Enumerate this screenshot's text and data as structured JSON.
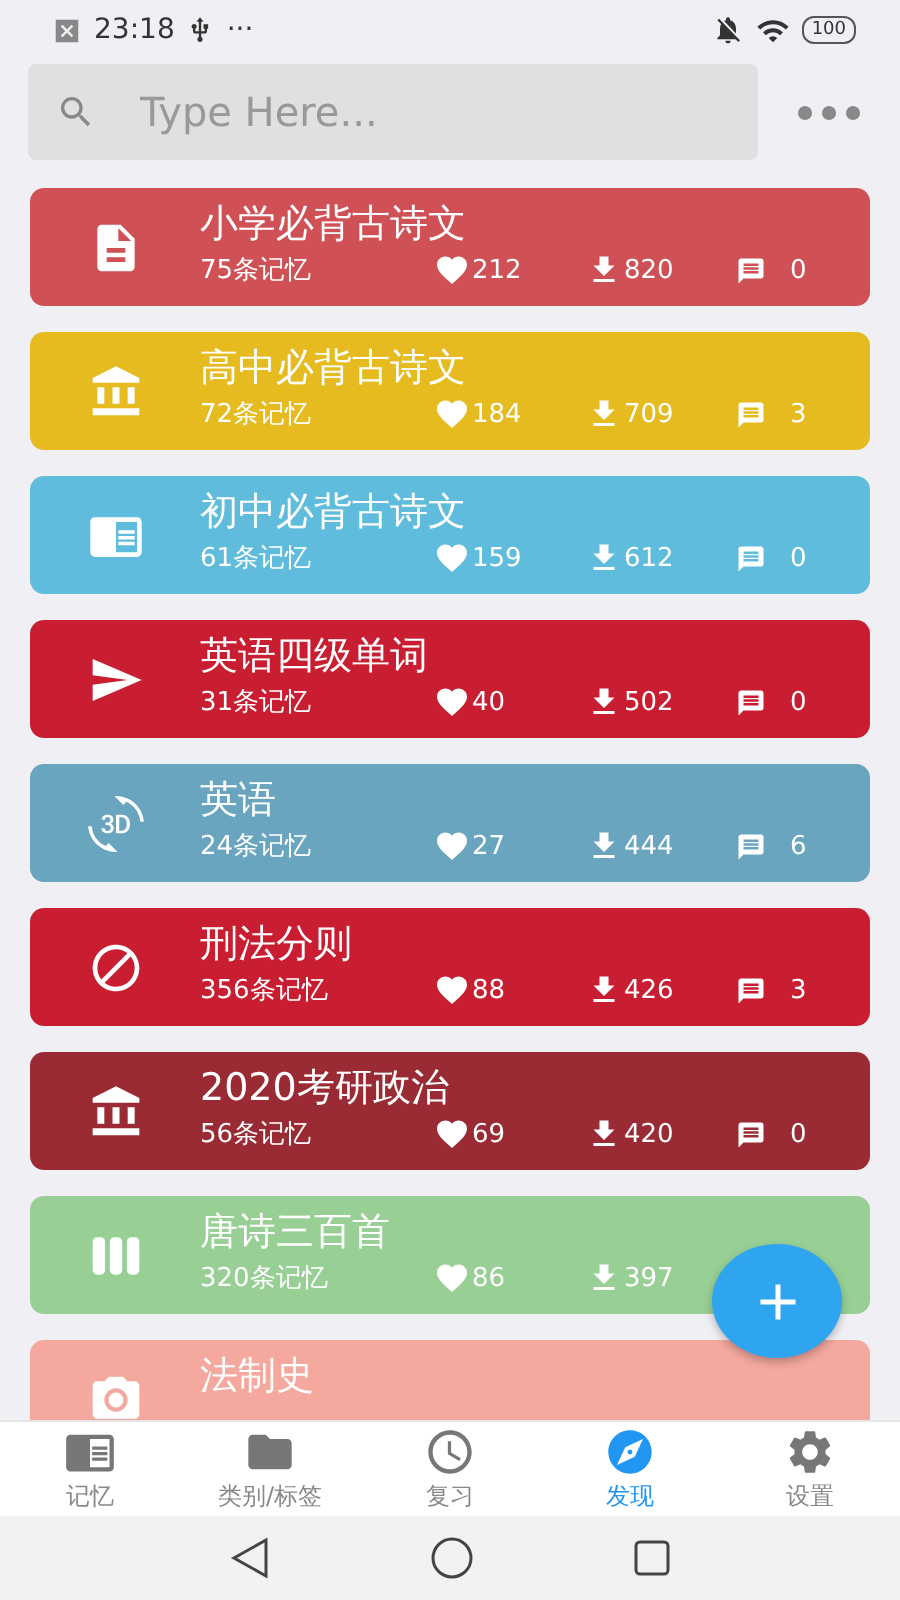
{
  "status_bar": {
    "time": "23:18",
    "more": "···",
    "battery": "100"
  },
  "search": {
    "placeholder": "Type Here..."
  },
  "decks": [
    {
      "title": "小学必背古诗文",
      "count": "75条记忆",
      "likes": "212",
      "downloads": "820",
      "comments": "0",
      "color": "#cf5155"
    },
    {
      "title": "高中必背古诗文",
      "count": "72条记忆",
      "likes": "184",
      "downloads": "709",
      "comments": "3",
      "color": "#e5bb1f"
    },
    {
      "title": "初中必背古诗文",
      "count": "61条记忆",
      "likes": "159",
      "downloads": "612",
      "comments": "0",
      "color": "#5fbcdc"
    },
    {
      "title": "英语四级单词",
      "count": "31条记忆",
      "likes": "40",
      "downloads": "502",
      "comments": "0",
      "color": "#c91d31"
    },
    {
      "title": "英语",
      "count": "24条记忆",
      "likes": "27",
      "downloads": "444",
      "comments": "6",
      "color": "#6aa5bf"
    },
    {
      "title": "刑法分则",
      "count": "356条记忆",
      "likes": "88",
      "downloads": "426",
      "comments": "3",
      "color": "#c91d31"
    },
    {
      "title": "2020考研政治",
      "count": "56条记忆",
      "likes": "69",
      "downloads": "420",
      "comments": "0",
      "color": "#9a2a33"
    },
    {
      "title": "唐诗三百首",
      "count": "320条记忆",
      "likes": "86",
      "downloads": "397",
      "color": "#98cf95"
    },
    {
      "title": "法制史",
      "color": "#f4a89e"
    }
  ],
  "tabs": [
    {
      "label": "记忆",
      "selected": false
    },
    {
      "label": "类别/标签",
      "selected": false
    },
    {
      "label": "复习",
      "selected": false
    },
    {
      "label": "发现",
      "selected": true
    },
    {
      "label": "设置",
      "selected": false
    }
  ]
}
